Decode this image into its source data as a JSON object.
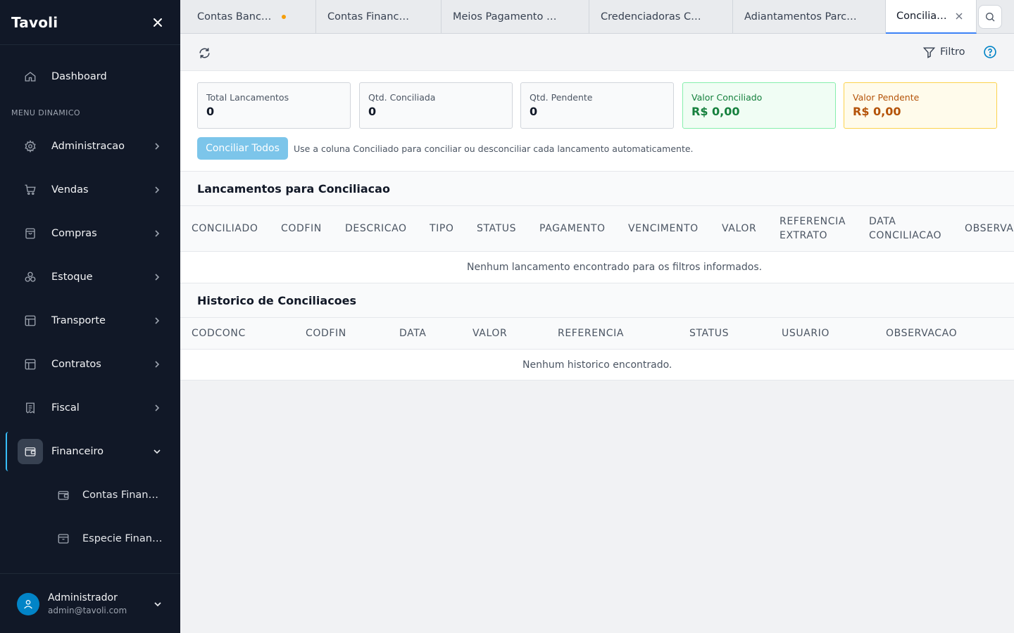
{
  "app": {
    "brand": "Tavoli"
  },
  "sidebar": {
    "dashboard": "Dashboard",
    "section_label": "MENU DINAMICO",
    "items": [
      {
        "label": "Administracao",
        "icon": "gear-icon"
      },
      {
        "label": "Vendas",
        "icon": "cart-icon"
      },
      {
        "label": "Compras",
        "icon": "bag-icon"
      },
      {
        "label": "Estoque",
        "icon": "boxes-icon"
      },
      {
        "label": "Transporte",
        "icon": "layout-icon"
      },
      {
        "label": "Contratos",
        "icon": "layout-icon"
      },
      {
        "label": "Fiscal",
        "icon": "receipt-icon"
      },
      {
        "label": "Financeiro",
        "icon": "wallet-icon"
      }
    ],
    "subitems": [
      {
        "label": "Contas Financeiras",
        "icon": "wallet-icon"
      },
      {
        "label": "Especie Financeira",
        "icon": "archive-icon"
      }
    ],
    "user": {
      "name": "Administrador",
      "email": "admin@tavoli.com"
    }
  },
  "tabs": [
    {
      "label": "Contas Banc…",
      "modified": true
    },
    {
      "label": "Contas Financ…"
    },
    {
      "label": "Meios Pagamento …"
    },
    {
      "label": "Credenciadoras C…"
    },
    {
      "label": "Adiantamentos Parc…"
    },
    {
      "label": "Concilia…",
      "active": true
    }
  ],
  "toolbar": {
    "filter_label": "Filtro"
  },
  "summary": {
    "cards": [
      {
        "label": "Total Lancamentos",
        "value": "0"
      },
      {
        "label": "Qtd. Conciliada",
        "value": "0"
      },
      {
        "label": "Qtd. Pendente",
        "value": "0"
      },
      {
        "label": "Valor Conciliado",
        "value": "R$ 0,00"
      },
      {
        "label": "Valor Pendente",
        "value": "R$ 0,00"
      }
    ],
    "button_label": "Conciliar Todos",
    "hint": "Use a coluna Conciliado para conciliar ou desconciliar cada lancamento automaticamente."
  },
  "lancamentos": {
    "title": "Lancamentos para Conciliacao",
    "columns": [
      "CONCILIADO",
      "CODFIN",
      "DESCRICAO",
      "TIPO",
      "STATUS",
      "PAGAMENTO",
      "VENCIMENTO",
      "VALOR",
      "REFERENCIA\nEXTRATO",
      "DATA\nCONCILIACAO",
      "OBSERVACAO"
    ],
    "empty": "Nenhum lancamento encontrado para os filtros informados."
  },
  "historico": {
    "title": "Historico de Conciliacoes",
    "columns": [
      "CODCONC",
      "CODFIN",
      "DATA",
      "VALOR",
      "REFERENCIA",
      "STATUS",
      "USUARIO",
      "OBSERVACAO"
    ],
    "empty": "Nenhum historico encontrado."
  },
  "colors": {
    "sidebar_bg": "#111827",
    "accent": "#3b82f6",
    "button": "#7cc5ea",
    "success": "#15803d",
    "warning": "#b45309"
  }
}
